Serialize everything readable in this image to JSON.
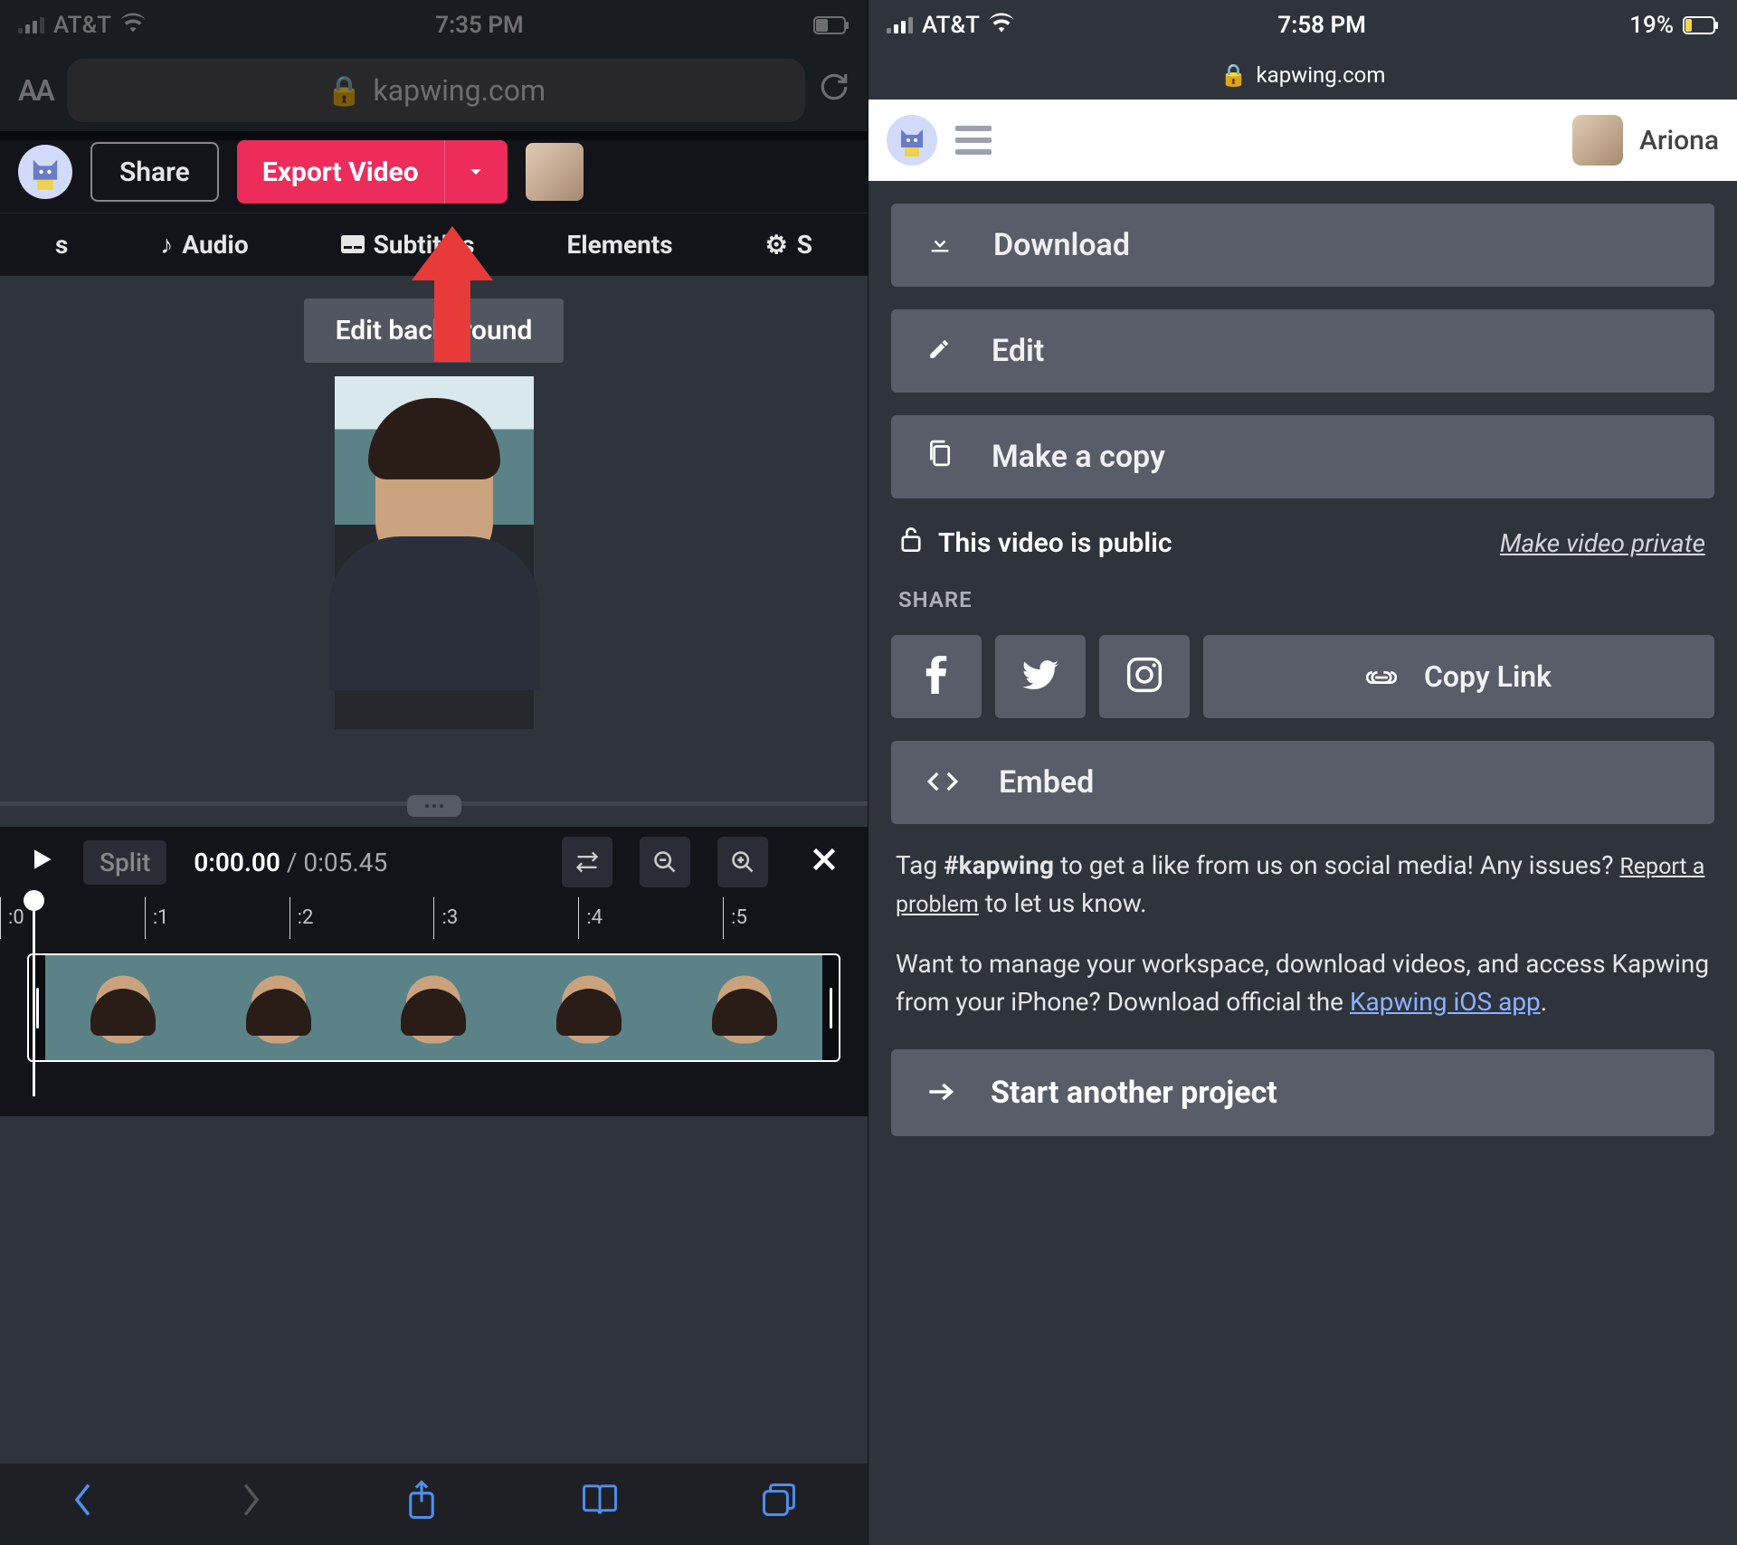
{
  "left": {
    "status": {
      "carrier": "AT&T",
      "time": "7:35 PM"
    },
    "url": {
      "domain": "kapwing.com",
      "aa": "AA"
    },
    "topbar": {
      "share": "Share",
      "export": "Export Video"
    },
    "toolbar": {
      "items": [
        {
          "icon": "s",
          "label": "s"
        },
        {
          "icon": "audio",
          "label": "Audio"
        },
        {
          "icon": "cc",
          "label": "Subtitles"
        },
        {
          "icon": "elem",
          "label": "Elements"
        },
        {
          "icon": "gear",
          "label": "S"
        }
      ]
    },
    "edit_bg": "Edit background",
    "timeline": {
      "split": "Split",
      "current": "0:00.00",
      "total": "0:05.45",
      "ticks": [
        ":0",
        ":1",
        ":2",
        ":3",
        ":4",
        ":5"
      ]
    }
  },
  "right": {
    "status": {
      "carrier": "AT&T",
      "time": "7:58 PM",
      "battery": "19%"
    },
    "url": {
      "domain": "kapwing.com"
    },
    "user": "Ariona",
    "buttons": {
      "download": "Download",
      "edit": "Edit",
      "copy": "Make a copy",
      "embed": "Embed",
      "copylink": "Copy Link",
      "start": "Start another project"
    },
    "public_text": "This video is public",
    "private_link": "Make video private",
    "share_label": "SHARE",
    "tag_text1": "Tag ",
    "tag_hashtag": "#kapwing",
    "tag_text2": " to get a like from us on social media! Any issues? ",
    "report": "Report a problem",
    "tag_text3": " to let us know.",
    "manage_text1": "Want to manage your workspace, download videos, and access Kapwing from your iPhone? Download official the ",
    "ios_link": "Kapwing iOS app",
    "manage_text2": "."
  }
}
